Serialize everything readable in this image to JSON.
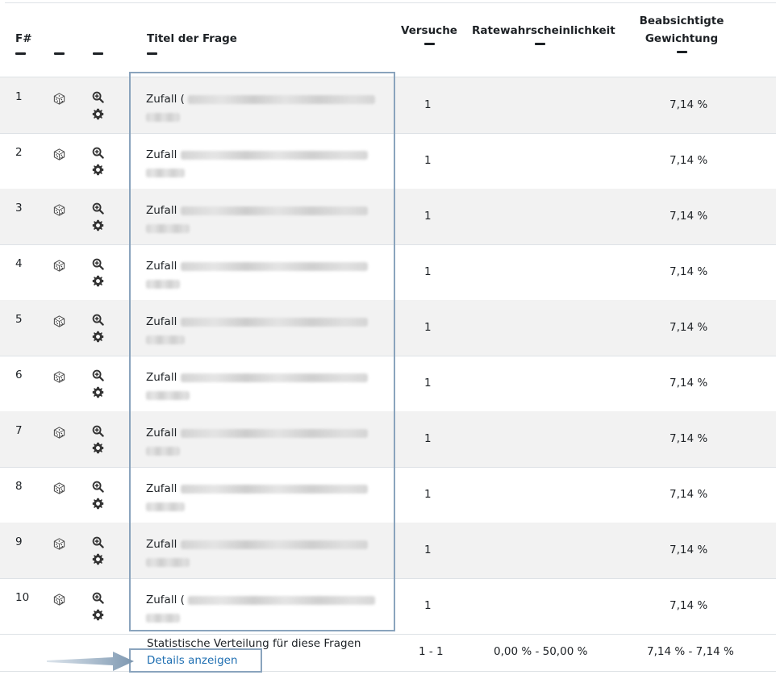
{
  "headers": {
    "slot": "F#",
    "title": "Titel der Frage",
    "attempts": "Versuche",
    "guess": "Ratewahrscheinlichkeit",
    "weight_line1": "Beabsichtigte",
    "weight_line2": "Gewichtung"
  },
  "rows": [
    {
      "num": "1",
      "title": "Zufall (",
      "attempts": "1",
      "weight": "7,14 %"
    },
    {
      "num": "2",
      "title": "Zufall",
      "attempts": "1",
      "weight": "7,14 %"
    },
    {
      "num": "3",
      "title": "Zufall",
      "attempts": "1",
      "weight": "7,14 %"
    },
    {
      "num": "4",
      "title": "Zufall",
      "attempts": "1",
      "weight": "7,14 %"
    },
    {
      "num": "5",
      "title": "Zufall",
      "attempts": "1",
      "weight": "7,14 %"
    },
    {
      "num": "6",
      "title": "Zufall",
      "attempts": "1",
      "weight": "7,14 %"
    },
    {
      "num": "7",
      "title": "Zufall",
      "attempts": "1",
      "weight": "7,14 %"
    },
    {
      "num": "8",
      "title": "Zufall",
      "attempts": "1",
      "weight": "7,14 %"
    },
    {
      "num": "9",
      "title": "Zufall",
      "attempts": "1",
      "weight": "7,14 %"
    },
    {
      "num": "10",
      "title": "Zufall (",
      "attempts": "1",
      "weight": "7,14 %"
    }
  ],
  "icons": {
    "dice": "dice-icon",
    "preview": "magnifier-plus-icon",
    "settings": "gear-icon"
  },
  "footer": {
    "label": "Statistische Verteilung für diese Fragen",
    "link": "Details anzeigen",
    "attempts_range": "1 - 1",
    "guess_range": "0,00 % - 50,00 %",
    "weight_range": "7,14 % - 7,14 %"
  },
  "colors": {
    "link": "#1f6fb2",
    "callout": "#8aa4bd",
    "stripe": "#f2f2f2"
  }
}
